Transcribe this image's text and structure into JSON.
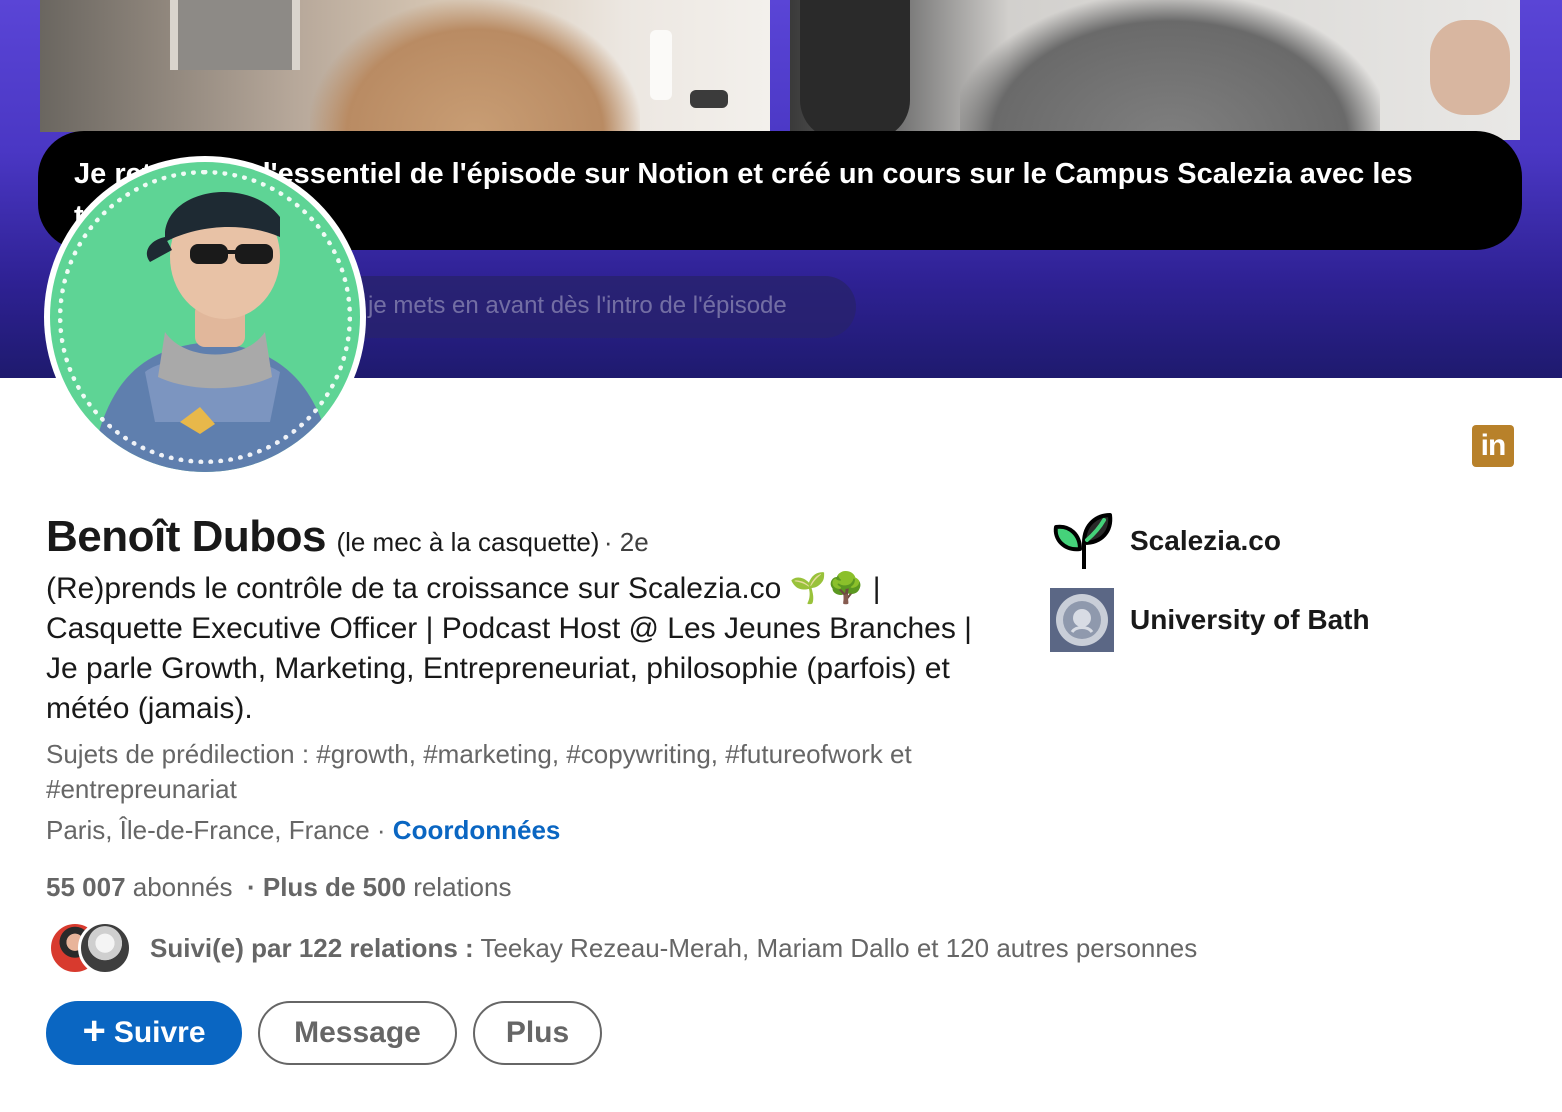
{
  "banner": {
    "caption": "Je retrouvais l'essentiel de l'épisode sur Notion et créé un cours sur le Campus Scalezia avec les templates Notion",
    "subcaption": "je mets en avant dès l'intro de l'épisode"
  },
  "profile": {
    "name": "Benoît Dubos",
    "nickname": "(le mec à la casquette)",
    "degree": "· 2e",
    "headline": "(Re)prends le contrôle de ta croissance sur Scalezia.co 🌱🌳 | Casquette Executive Officer | Podcast Host @ Les Jeunes Branches | Je parle Growth, Marketing, Entrepreneuriat, philosophie (parfois) et météo (jamais).",
    "topics": "Sujets de prédilection : #growth, #marketing, #copywriting, #futureofwork et #entrepreunariat",
    "location": "Paris, Île-de-France, France ·",
    "contact_link": "Coordonnées",
    "followers_count": "55 007",
    "followers_label": "abonnés",
    "connections_prefix": "· Plus de 500",
    "connections_label": "relations",
    "followed_by_bold": "Suivi(e) par 122 relations :",
    "followed_by_names": "Teekay Rezeau-Merah, Mariam Dallo et 120 autres personnes"
  },
  "actions": {
    "follow": "Suivre",
    "message": "Message",
    "more": "Plus"
  },
  "orgs": [
    {
      "name": "Scalezia.co",
      "icon": "sprout-logo-icon"
    },
    {
      "name": "University of Bath",
      "icon": "university-seal-icon"
    }
  ],
  "icons": {
    "linkedin": "in"
  },
  "colors": {
    "primary": "#0a66c2",
    "avatar_bg": "#5ed495",
    "banner": "#4a37c4",
    "linkedin_badge": "#b8812a"
  }
}
